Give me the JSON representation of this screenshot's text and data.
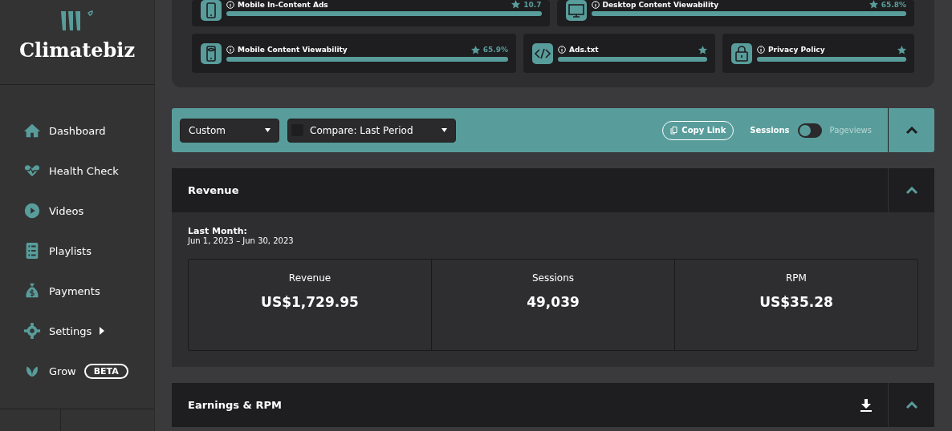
{
  "sidebar": {
    "brand": "Climatebiz",
    "items": [
      {
        "label": "Dashboard"
      },
      {
        "label": "Health Check"
      },
      {
        "label": "Videos"
      },
      {
        "label": "Playlists"
      },
      {
        "label": "Payments"
      },
      {
        "label": "Settings",
        "submenu": true
      },
      {
        "label": "Grow",
        "badge": "BETA"
      }
    ]
  },
  "health_cards": [
    [
      {
        "title": "Mobile In-Content Ads",
        "kind": "mobile",
        "score": "10.7",
        "level": 1
      },
      {
        "title": "Desktop Content Viewability",
        "kind": "desktop",
        "score": "65.8%",
        "level": 1
      }
    ],
    [
      {
        "title": "Mobile Content Viewability",
        "kind": "mobileview",
        "score": "65.9%",
        "level": 1
      },
      {
        "title": "Ads.txt",
        "kind": "code",
        "level": 1
      },
      {
        "title": "Privacy Policy",
        "kind": "lock",
        "level": 1
      }
    ]
  ],
  "toolbar": {
    "range": "Custom",
    "compare": {
      "label": "Compare: Last Period",
      "checked": false
    },
    "copy_link": "Copy Link",
    "toggle": {
      "left": "Sessions",
      "right": "Pageviews",
      "on": false
    }
  },
  "revenue": {
    "title": "Revenue",
    "period_label": "Last Month:",
    "period": "Jun 1, 2023 – Jun 30, 2023",
    "metrics": [
      {
        "label": "Revenue",
        "value": "US$1,729.95"
      },
      {
        "label": "Sessions",
        "value": "49,039"
      },
      {
        "label": "RPM",
        "value": "US$35.28"
      }
    ]
  },
  "earnings": {
    "title": "Earnings & RPM"
  }
}
